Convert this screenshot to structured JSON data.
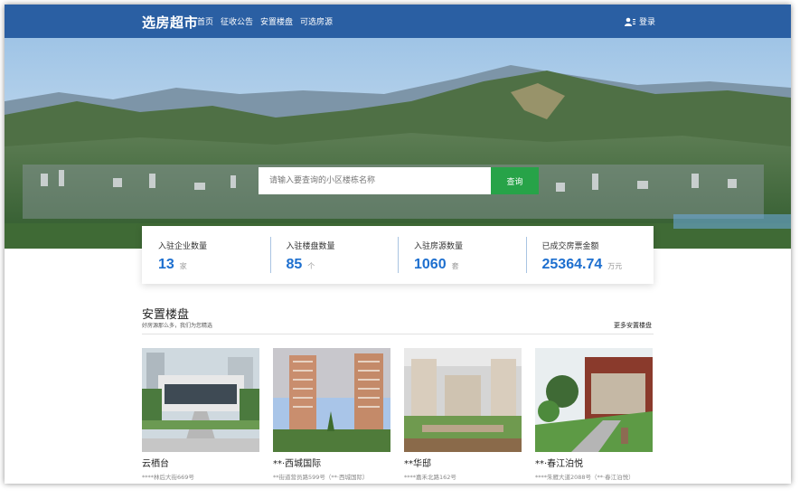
{
  "nav": {
    "brand": "选房超市",
    "links": [
      "首页",
      "征收公告",
      "安置楼盘",
      "可选房源"
    ],
    "login": "登录"
  },
  "search": {
    "placeholder": "请输入要查询的小区楼栋名称",
    "button": "查询"
  },
  "stats": [
    {
      "label": "入驻企业数量",
      "value": "13",
      "unit": "家"
    },
    {
      "label": "入驻楼盘数量",
      "value": "85",
      "unit": "个"
    },
    {
      "label": "入驻房源数量",
      "value": "1060",
      "unit": "套"
    },
    {
      "label": "已成交房票金额",
      "value": "25364.74",
      "unit": "万元"
    }
  ],
  "section": {
    "title": "安置楼盘",
    "subtitle": "好房源那么多，我们为您精选",
    "more": "更多安置楼盘"
  },
  "properties": [
    {
      "name": "云栖台",
      "address": "****林后大街669号"
    },
    {
      "name": "**·西城国际",
      "address": "**街道营员路599号（**·西城国际）"
    },
    {
      "name": "**华邸",
      "address": "****嘉禾北路162号"
    },
    {
      "name": "**·春江泊悦",
      "address": "****朱雁大道2088号（**·春江泊悦）"
    }
  ],
  "colors": {
    "nav": "#2a5fa3",
    "accent_blue": "#1d6fcf",
    "search_button": "#27a348"
  },
  "icons": {
    "login": "user-icon"
  }
}
